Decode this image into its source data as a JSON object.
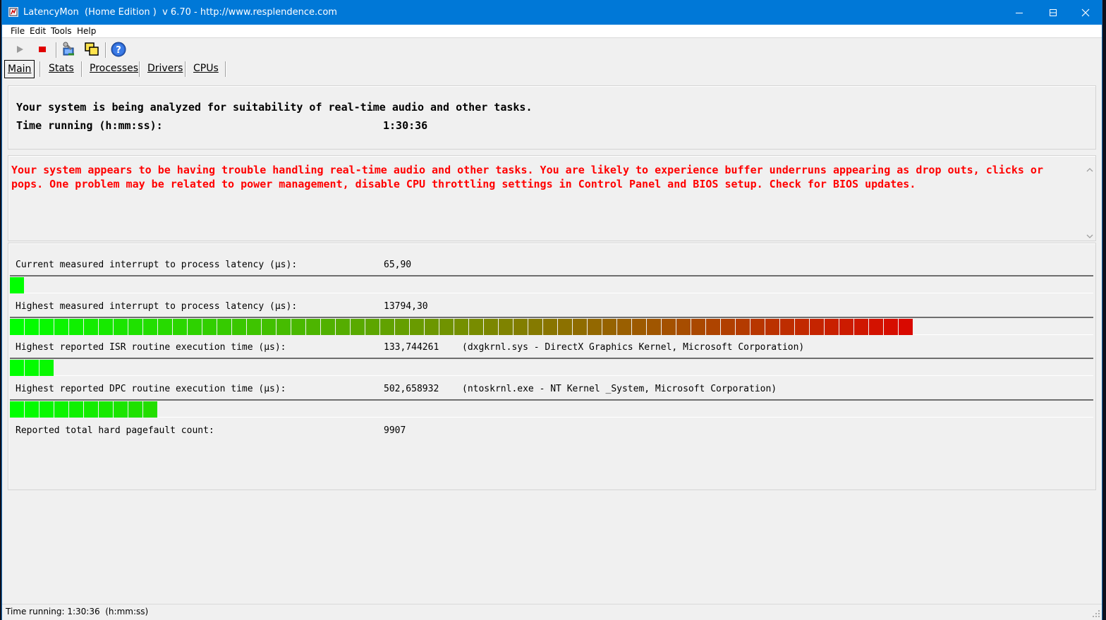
{
  "window": {
    "title": "LatencyMon  (Home Edition )  v 6.70 - http://www.resplendence.com"
  },
  "menu": [
    {
      "label": "File"
    },
    {
      "label": "Edit"
    },
    {
      "label": "Tools"
    },
    {
      "label": "Help"
    }
  ],
  "toolbar": {
    "icons": [
      "play-icon",
      "stop-icon",
      "tools-icon",
      "windows-icon",
      "help-icon"
    ]
  },
  "tabs": [
    {
      "label": "Main"
    },
    {
      "label": "Stats"
    },
    {
      "label": "Processes"
    },
    {
      "label": "Drivers"
    },
    {
      "label": "CPUs"
    }
  ],
  "summary": {
    "line1": "Your system is being analyzed for suitability of real-time audio and other tasks.",
    "time_label": "Time running (h:mm:ss):",
    "time_value": "1:30:36"
  },
  "warning": {
    "text": "Your system appears to be having trouble handling real-time audio and other tasks. You are likely to experience buffer underruns appearing as drop outs, clicks or pops. One problem may be related to power management, disable CPU throttling settings in Control Panel and BIOS setup. Check for BIOS updates.",
    "color": "#ff0000"
  },
  "metrics": [
    {
      "label": "Current measured interrupt to process latency (µs):",
      "value": "65,90",
      "extra": "",
      "bar_segments": 1
    },
    {
      "label": "Highest measured interrupt to process latency (µs):",
      "value": "13794,30",
      "extra": "",
      "bar_segments": 61
    },
    {
      "label": "Highest reported ISR routine execution time (µs):",
      "value": "133,744261",
      "extra": "(dxgkrnl.sys - DirectX Graphics Kernel, Microsoft Corporation)",
      "bar_segments": 3
    },
    {
      "label": "Highest reported DPC routine execution time (µs):",
      "value": "502,658932",
      "extra": "(ntoskrnl.exe - NT Kernel _System, Microsoft Corporation)",
      "bar_segments": 10
    },
    {
      "label": "Reported total hard pagefault count:",
      "value": "9907",
      "extra": ""
    }
  ],
  "statusbar": {
    "text": "Time running: 1:30:36  (h:mm:ss)"
  },
  "colors": {
    "titlebar": "#0078d7",
    "bar_start": "#00ff00",
    "bar_end": "#e00000"
  }
}
